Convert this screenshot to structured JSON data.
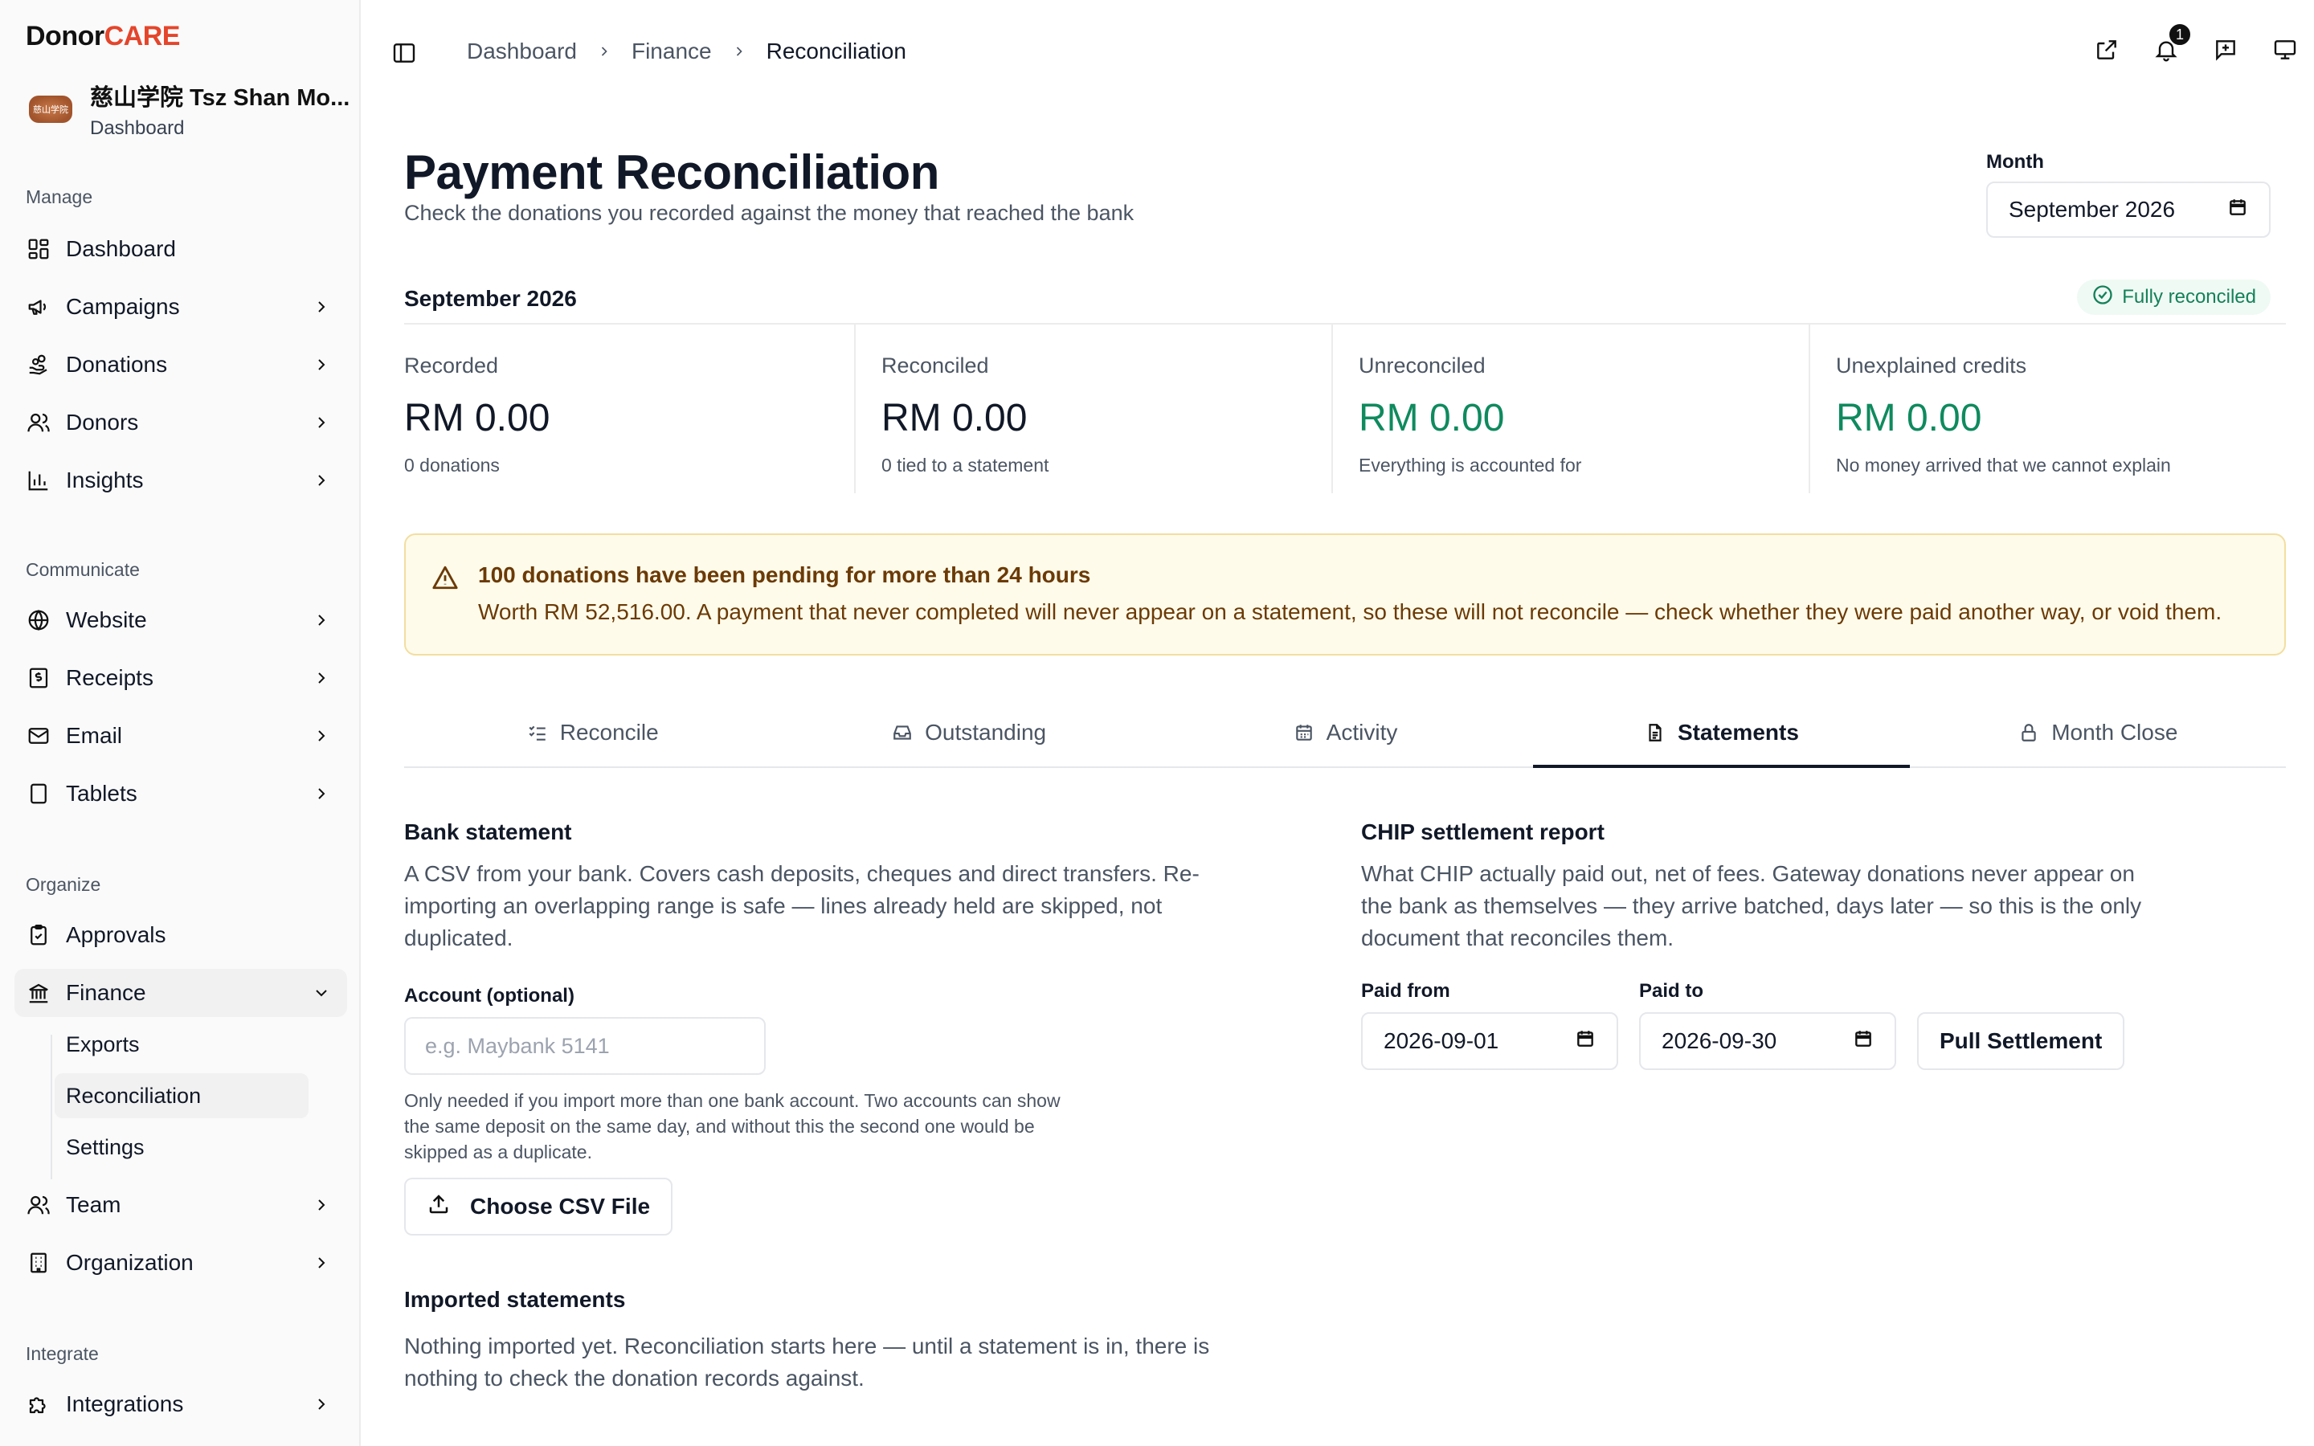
{
  "brand": {
    "donor": "Donor",
    "care": "CARE"
  },
  "org": {
    "name": "慈山学院 Tsz Shan Mo...",
    "sub": "Dashboard",
    "avatar_text": "慈山学院"
  },
  "sidebar": {
    "sections": {
      "manage": "Manage",
      "communicate": "Communicate",
      "organize": "Organize",
      "integrate": "Integrate"
    },
    "items": {
      "dashboard": "Dashboard",
      "campaigns": "Campaigns",
      "donations": "Donations",
      "donors": "Donors",
      "insights": "Insights",
      "website": "Website",
      "receipts": "Receipts",
      "email": "Email",
      "tablets": "Tablets",
      "approvals": "Approvals",
      "finance": "Finance",
      "team": "Team",
      "organization": "Organization",
      "integrations": "Integrations"
    },
    "finance_sub": {
      "exports": "Exports",
      "reconciliation": "Reconciliation",
      "settings": "Settings"
    }
  },
  "breadcrumb": {
    "level1": "Dashboard",
    "level2": "Finance",
    "current": "Reconciliation"
  },
  "notifications": {
    "count": "1"
  },
  "page": {
    "title": "Payment Reconciliation",
    "subtitle": "Check the donations you recorded against the money that reached the bank",
    "month_label": "Month",
    "month_value": "September 2026"
  },
  "summary": {
    "period": "September 2026",
    "status": "Fully reconciled",
    "stats": {
      "recorded": {
        "label": "Recorded",
        "value": "RM 0.00",
        "sub": "0 donations"
      },
      "reconciled": {
        "label": "Reconciled",
        "value": "RM 0.00",
        "sub": "0 tied to a statement"
      },
      "unreconciled": {
        "label": "Unreconciled",
        "value": "RM 0.00",
        "sub": "Everything is accounted for"
      },
      "unexplained": {
        "label": "Unexplained credits",
        "value": "RM 0.00",
        "sub": "No money arrived that we cannot explain"
      }
    }
  },
  "alert": {
    "title": "100 donations have been pending for more than 24 hours",
    "text": "Worth RM 52,516.00. A payment that never completed will never appear on a statement, so these will not reconcile — check whether they were paid another way, or void them."
  },
  "tabs": {
    "reconcile": "Reconcile",
    "outstanding": "Outstanding",
    "activity": "Activity",
    "statements": "Statements",
    "month_close": "Month Close"
  },
  "bank": {
    "heading": "Bank statement",
    "description": "A CSV from your bank. Covers cash deposits, cheques and direct transfers. Re-importing an overlapping range is safe — lines already held are skipped, not duplicated.",
    "account_label": "Account (optional)",
    "account_placeholder": "e.g. Maybank 5141",
    "account_value": "",
    "help": "Only needed if you import more than one bank account. Two accounts can show the same deposit on the same day, and without this the second one would be skipped as a duplicate.",
    "upload_button": "Choose CSV File"
  },
  "imported": {
    "heading": "Imported statements",
    "empty": "Nothing imported yet. Reconciliation starts here — until a statement is in, there is nothing to check the donation records against."
  },
  "chip": {
    "heading": "CHIP settlement report",
    "description": "What CHIP actually paid out, net of fees. Gateway donations never appear on the bank as themselves — they arrive batched, days later — so this is the only document that reconciles them.",
    "paid_from_label": "Paid from",
    "paid_from": "2026-09-01",
    "paid_to_label": "Paid to",
    "paid_to": "2026-09-30",
    "pull_button": "Pull Settlement"
  },
  "colors": {
    "accent_green": "#0f8a5f",
    "brand_red": "#e4452b",
    "warning_text": "#6b3a06",
    "warning_bg": "#fffbea"
  }
}
